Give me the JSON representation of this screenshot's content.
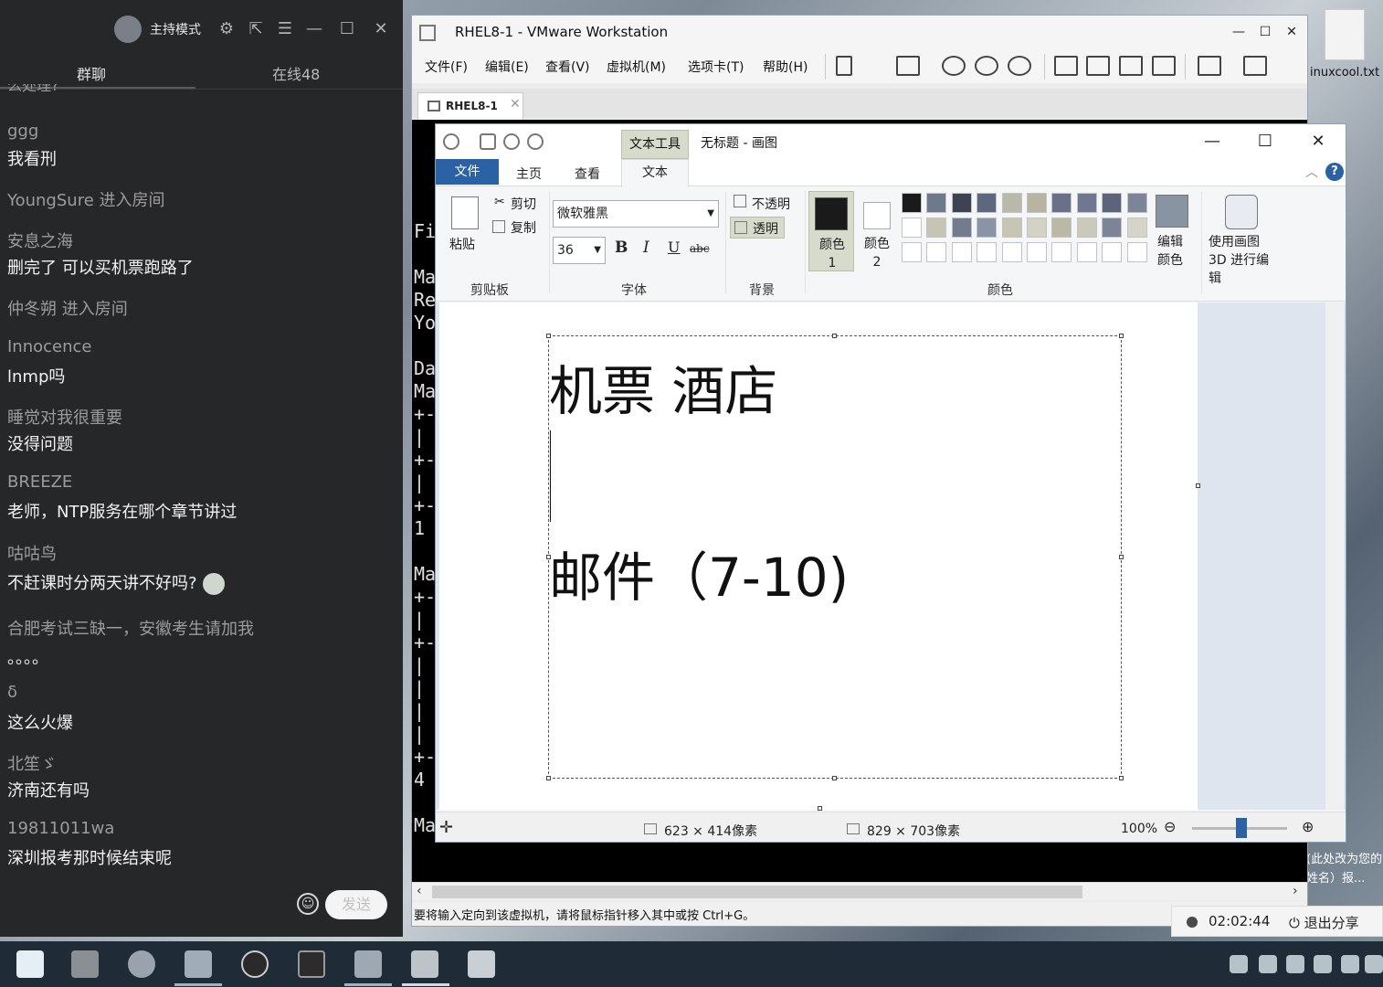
{
  "desktop": {
    "file_label": "inuxcool.txt",
    "note": "(此处改为您的姓名）报..."
  },
  "chat": {
    "mode": "主持模式",
    "tabs": [
      "群聊",
      "在线48"
    ],
    "cut_text": "么处理?",
    "messages": [
      {
        "name": "ggg",
        "text": "我看刑"
      },
      {
        "name": "YoungSure 进入房间",
        "text": ""
      },
      {
        "name": "安息之海",
        "text": "删完了 可以买机票跑路了"
      },
      {
        "name": "仲冬朔 进入房间",
        "text": ""
      },
      {
        "name": "Innocence",
        "text": "lnmp吗"
      },
      {
        "name": "睡觉对我很重要",
        "text": "没得问题"
      },
      {
        "name": "BREEZE",
        "text": "老师，NTP服务在哪个章节讲过"
      },
      {
        "name": "咕咕鸟",
        "text": "不赶课时分两天讲不好吗?"
      },
      {
        "name": "合肥考试三缺一，安徽考生请加我",
        "text": "。。。。"
      },
      {
        "name": "δ",
        "text": "这么火爆"
      },
      {
        "name": "北笙ゞ",
        "text": "济南还有吗"
      },
      {
        "name": "19811011wa",
        "text": "深圳报考那时候结束呢"
      }
    ],
    "send_label": "发送",
    "icons": [
      "settings-icon",
      "external-link-icon",
      "menu-icon",
      "minimize-icon",
      "maximize-icon",
      "close-icon",
      "emoji-icon"
    ]
  },
  "vmware": {
    "title": "RHEL8-1 - VMware Workstation",
    "menu": [
      "文件(F)",
      "编辑(E)",
      "查看(V)",
      "虚拟机(M)",
      "选项卡(T)",
      "帮助(H)"
    ],
    "tab_label": "RHEL8-1",
    "terminal_lines": [
      "Fil",
      "",
      "Ma",
      "Re",
      "Yo",
      "",
      "Da",
      "Ma",
      "+-",
      "|",
      "+-",
      "|",
      "+-",
      "1",
      "",
      "Ma",
      "+-",
      "|",
      "+-",
      "|",
      "|",
      "|",
      "|",
      "+-",
      "4",
      "",
      "Ma"
    ],
    "status_text": "要将输入定向到该虚拟机，请将鼠标指针移入其中或按 Ctrl+G。"
  },
  "paint": {
    "text_tool_tab": "文本工具",
    "title": "无标题 - 画图",
    "ribbon_tabs": [
      "文件",
      "主页",
      "查看",
      "文本"
    ],
    "clipboard": {
      "paste": "粘贴",
      "cut": "剪切",
      "copy": "复制",
      "group": "剪贴板"
    },
    "font": {
      "family": "微软雅黑",
      "size": "36",
      "group": "字体"
    },
    "background": {
      "opaque": "不透明",
      "transparent": "透明",
      "group": "背景"
    },
    "colors": {
      "color1": "颜色 1",
      "color2": "颜色 2",
      "edit": "编辑颜色",
      "paint3d": "使用画图 3D 进行编辑",
      "group": "颜色",
      "color1_value": "#1a1a1a",
      "color2_value": "#ffffff"
    },
    "canvas_text": [
      "机票 酒店",
      "邮件（7-10)"
    ],
    "status": {
      "selection": "623 × 414像素",
      "canvas": "829 × 703像素",
      "zoom": "100%"
    }
  },
  "sharebar": {
    "time": "02:02:44",
    "exit": "退出分享"
  }
}
